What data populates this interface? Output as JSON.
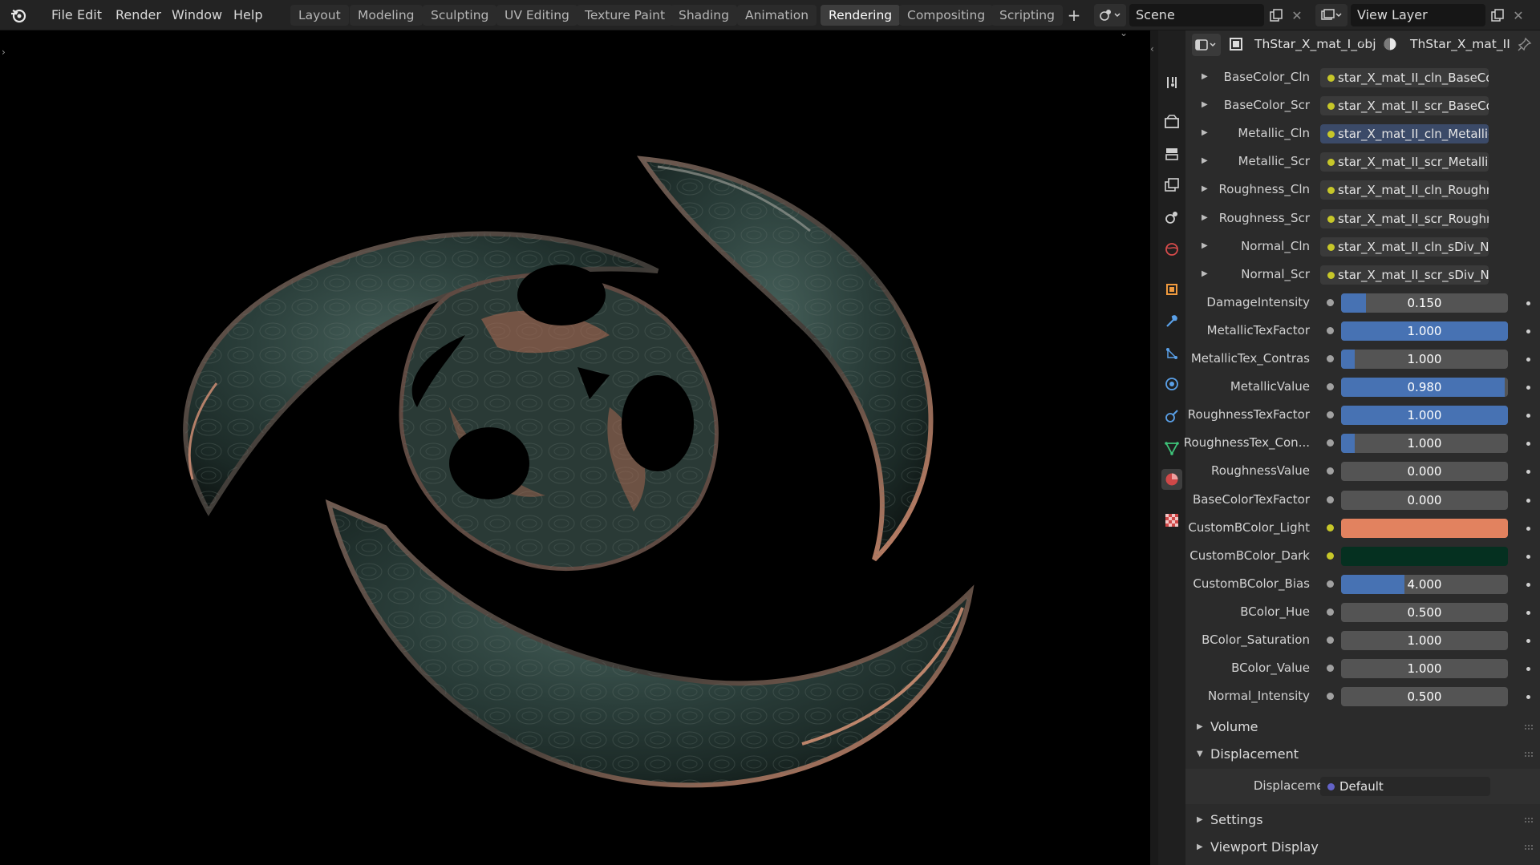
{
  "menu": [
    "File",
    "Edit",
    "Render",
    "Window",
    "Help"
  ],
  "workspaces": [
    "Layout",
    "Modeling",
    "Sculpting",
    "UV Editing",
    "Texture Paint",
    "Shading",
    "Animation",
    "Rendering",
    "Compositing",
    "Scripting"
  ],
  "active_workspace": "Rendering",
  "scene": {
    "name": "Scene"
  },
  "view_layer": {
    "name": "View Layer"
  },
  "properties": {
    "object_name": "ThStar_X_mat_I_obj",
    "material_name": "ThStar_X_mat_II",
    "texture_inputs": [
      {
        "label": "BaseColor_Cln",
        "value": "star_X_mat_II_cln_BaseColo..."
      },
      {
        "label": "BaseColor_Scr",
        "value": "star_X_mat_II_scr_BaseColo..."
      },
      {
        "label": "Metallic_Cln",
        "value": "star_X_mat_II_cln_Metallic...."
      },
      {
        "label": "Metallic_Scr",
        "value": "star_X_mat_II_scr_Metallic...."
      },
      {
        "label": "Roughness_Cln",
        "value": "star_X_mat_II_cln_Roughnes..."
      },
      {
        "label": "Roughness_Scr",
        "value": "star_X_mat_II_scr_Roughnes..."
      },
      {
        "label": "Normal_Cln",
        "value": "star_X_mat_II_cln_sDiv_Nor..."
      },
      {
        "label": "Normal_Scr",
        "value": "star_X_mat_II_scr_sDiv_Nor..."
      }
    ],
    "value_inputs": [
      {
        "label": "DamageIntensity",
        "value": "0.150",
        "fill": 0.15
      },
      {
        "label": "MetallicTexFactor",
        "value": "1.000",
        "fill": 1.0
      },
      {
        "label": "MetallicTex_Contras",
        "value": "1.000",
        "fill": 0.08
      },
      {
        "label": "MetallicValue",
        "value": "0.980",
        "fill": 0.98
      },
      {
        "label": "RoughnessTexFactor",
        "value": "1.000",
        "fill": 1.0
      },
      {
        "label": "RoughnessTex_Con...",
        "value": "1.000",
        "fill": 0.08
      },
      {
        "label": "RoughnessValue",
        "value": "0.000",
        "fill": 0
      },
      {
        "label": "BaseColorTexFactor",
        "value": "0.000",
        "fill": 0
      }
    ],
    "color_inputs": [
      {
        "label": "CustomBColor_Light",
        "color": "#e2825f"
      },
      {
        "label": "CustomBColor_Dark",
        "color": "#053020"
      }
    ],
    "value_inputs_2": [
      {
        "label": "CustomBColor_Bias",
        "value": "4.000",
        "fill": 0.38
      },
      {
        "label": "BColor_Hue",
        "value": "0.500",
        "fill": 0
      },
      {
        "label": "BColor_Saturation",
        "value": "1.000",
        "fill": 0
      },
      {
        "label": "BColor_Value",
        "value": "1.000",
        "fill": 0
      },
      {
        "label": "Normal_Intensity",
        "value": "0.500",
        "fill": 0
      }
    ],
    "panels": {
      "volume": "Volume",
      "displacement": "Displacement",
      "displacement_label": "Displacement",
      "displacement_value": "Default",
      "settings": "Settings",
      "viewport_display": "Viewport Display"
    }
  },
  "colors": {
    "accent_blue": "#4772b3",
    "active_tab": "#3d3d3d",
    "socket_yellow": "#c7c729",
    "socket_gray": "#a1a1a1",
    "socket_purple": "#6363c7"
  }
}
